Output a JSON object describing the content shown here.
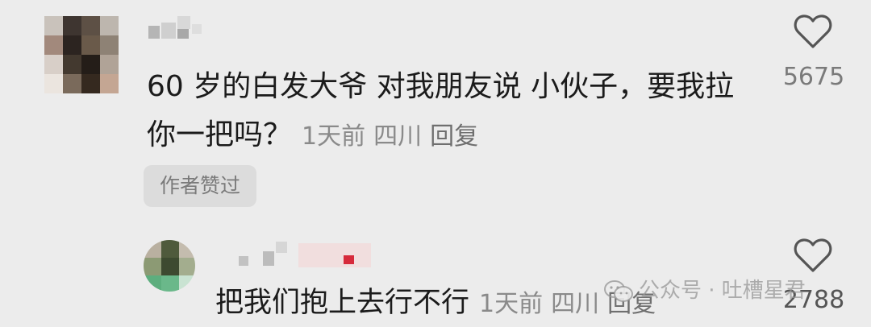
{
  "comments": [
    {
      "text": "60 岁的白发大爷 对我朋友说 小伙子，要我拉你一把吗？",
      "time": "1天前",
      "location": "四川",
      "reply_label": "回复",
      "likes": "5675",
      "badge": "作者赞过"
    },
    {
      "text": "把我们抱上去行不行",
      "time": "1天前",
      "location": "四川",
      "reply_label": "回复",
      "likes": "2788"
    }
  ],
  "watermark": {
    "text": "公众号 · 吐槽星君"
  },
  "icons": {
    "like": "heart-outline-icon",
    "watermark": "wechat-icon"
  },
  "colors": {
    "background": "#ececec",
    "text": "#1b1b1b",
    "meta": "#8a8a8a",
    "badge_bg": "#dcdcdc"
  }
}
